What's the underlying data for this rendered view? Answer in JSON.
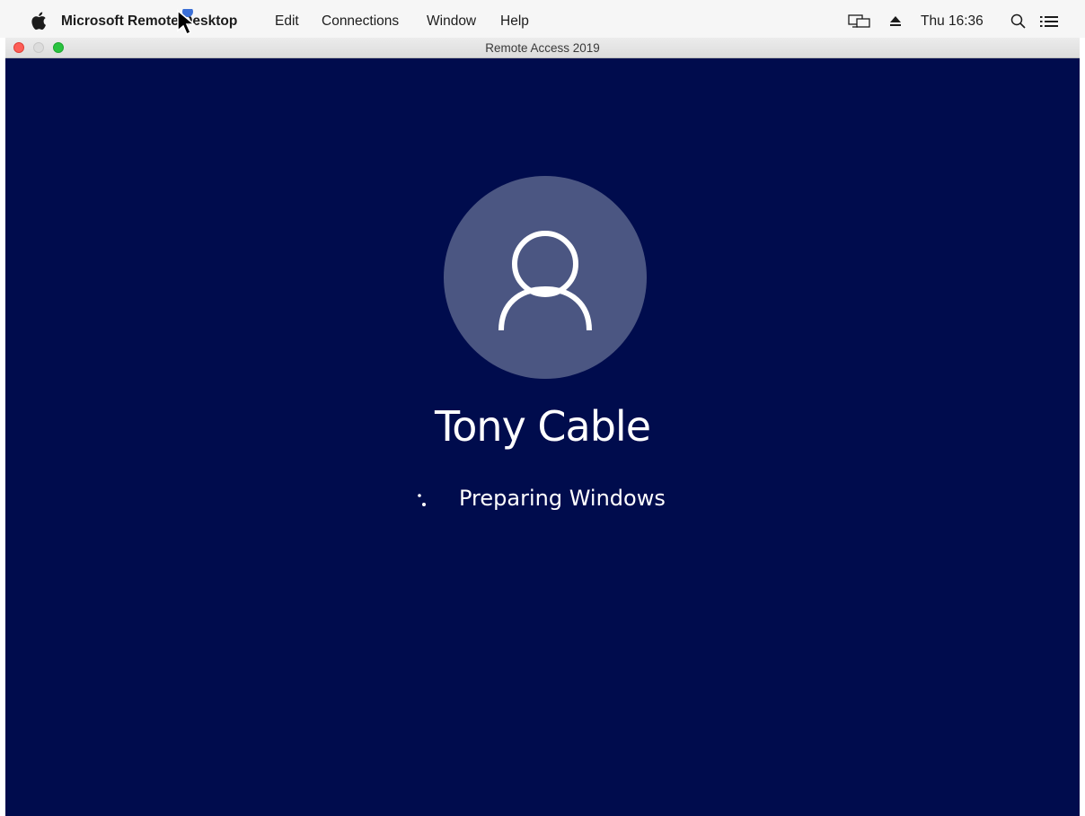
{
  "menubar": {
    "apple_icon": "apple-icon",
    "app_name": "Microsoft Remote Desktop",
    "menus": [
      "Edit",
      "Connections",
      "Window",
      "Help"
    ],
    "status_icons": [
      "display-icon",
      "eject-icon",
      "search-icon",
      "list-icon"
    ],
    "clock": "Thu 16:36"
  },
  "window": {
    "title": "Remote Access 2019"
  },
  "login": {
    "avatar_icon": "user-icon",
    "user_name": "Tony Cable",
    "status": "Preparing Windows",
    "spinner_icon": "loading-spinner-icon"
  },
  "colors": {
    "desktop_background": "#000c4d",
    "avatar_background": "#4b5682",
    "close": "#fd5e57",
    "zoom": "#29c33f"
  }
}
